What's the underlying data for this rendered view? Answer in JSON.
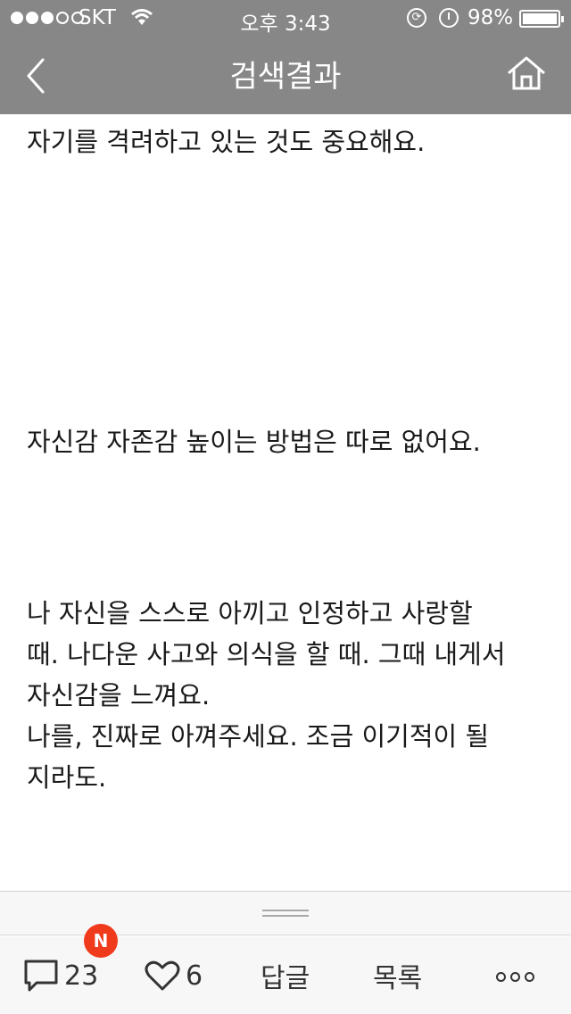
{
  "status_bar": {
    "carrier": "SKT",
    "time": "오후 3:43",
    "battery": "98%"
  },
  "nav": {
    "title": "검색결과",
    "back_icon": "chevron-left-icon",
    "home_icon": "home-icon"
  },
  "content": {
    "paragraphs": [
      "자기를 격려하고 있는 것도 중요해요.",
      "자신감 자존감 높이는 방법은 따로 없어요.",
      "나 자신을 스스로 아끼고 인정하고 사랑할\n때. 나다운 사고와 의식을 할 때. 그때 내게서\n자신감을 느껴요.\n나를, 진짜로 아껴주세요. 조금 이기적이 될\n지라도."
    ]
  },
  "toolbar": {
    "new_badge": "N",
    "comment_count": "23",
    "like_count": "6",
    "reply_label": "답글",
    "list_label": "목록",
    "more_icon": "more-dots-icon"
  }
}
